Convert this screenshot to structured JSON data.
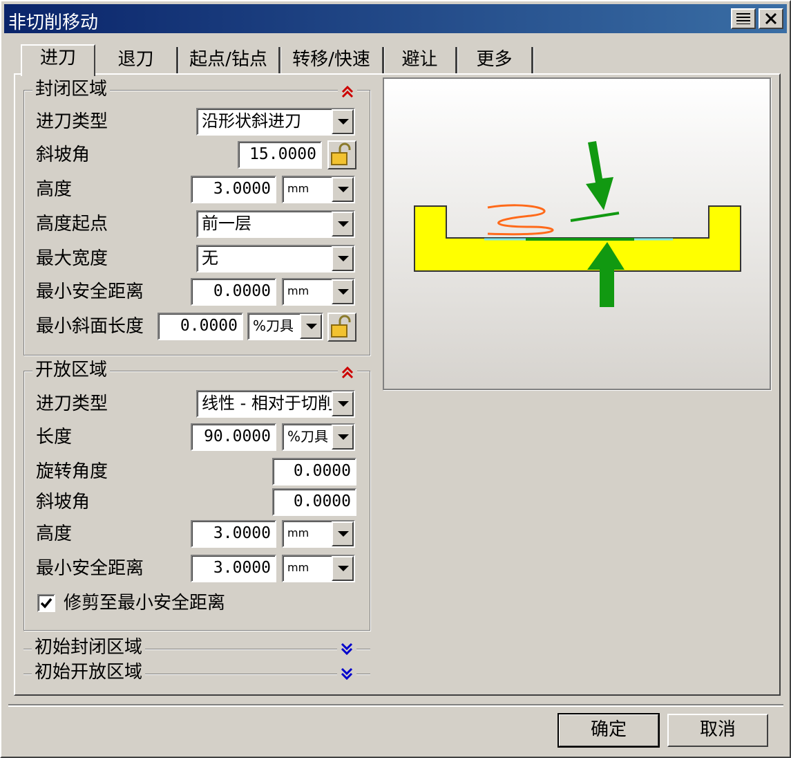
{
  "window": {
    "title": "非切削移动"
  },
  "tabs": [
    {
      "label": "进刀"
    },
    {
      "label": "退刀"
    },
    {
      "label": "起点/钻点"
    },
    {
      "label": "转移/快速"
    },
    {
      "label": "避让"
    },
    {
      "label": "更多"
    }
  ],
  "closed_area": {
    "title": "封闭区域",
    "entry_type": {
      "label": "进刀类型",
      "value": "沿形状斜进刀"
    },
    "ramp_angle": {
      "label": "斜坡角",
      "value": "15.0000"
    },
    "height": {
      "label": "高度",
      "value": "3.0000",
      "unit": "mm"
    },
    "height_from": {
      "label": "高度起点",
      "value": "前一层"
    },
    "max_width": {
      "label": "最大宽度",
      "value": "无"
    },
    "min_clearance": {
      "label": "最小安全距离",
      "value": "0.0000",
      "unit": "mm"
    },
    "min_ramp_length": {
      "label": "最小斜面长度",
      "value": "0.0000",
      "unit": "%刀具"
    }
  },
  "open_area": {
    "title": "开放区域",
    "entry_type": {
      "label": "进刀类型",
      "value": "线性 - 相对于切削"
    },
    "length": {
      "label": "长度",
      "value": "90.0000",
      "unit": "%刀具"
    },
    "rotation_angle": {
      "label": "旋转角度",
      "value": "0.0000"
    },
    "ramp_angle": {
      "label": "斜坡角",
      "value": "0.0000"
    },
    "height": {
      "label": "高度",
      "value": "3.0000",
      "unit": "mm"
    },
    "min_clearance": {
      "label": "最小安全距离",
      "value": "3.0000",
      "unit": "mm"
    },
    "trim_checkbox": {
      "label": "修剪至最小安全距离",
      "checked": true
    }
  },
  "initial_closed_area": {
    "title": "初始封闭区域"
  },
  "initial_open_area": {
    "title": "初始开放区域"
  },
  "footer": {
    "ok_label": "确定",
    "cancel_label": "取消"
  },
  "colors": {
    "titlebar": "#0a246a",
    "part_fill": "#ffff00",
    "arrow_green": "#119911",
    "helix_orange": "#ff6a1a",
    "floor_cyan": "#7fe7e7",
    "expand_red": "#cc0000",
    "collapse_blue": "#0000cc"
  }
}
